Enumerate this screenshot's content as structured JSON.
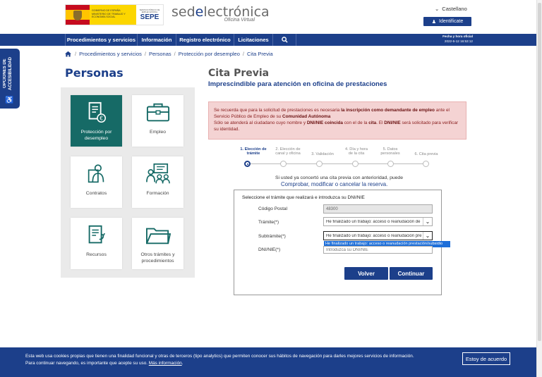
{
  "header": {
    "gov_text": "GOBIERNO DE ESPAÑA  MINISTERIO DE TRABAJO Y ECONOMÍA SOCIAL",
    "gov_right_text": "SERVICIO PÚBLICO DE EMPLEO ESTATAL",
    "sepe": "SEPE",
    "sede_pre": "sed",
    "sede_e": "e",
    "sede_post": "lectrónica",
    "sede_sub": "Oficina Virtual",
    "lang_label": "Castellano",
    "identify_label": "Identifícate"
  },
  "nav": {
    "items": [
      "Procedimientos y servicios",
      "Información",
      "Registro electrónico",
      "Licitaciones"
    ],
    "date_label": "Fecha y hora oficial",
    "date_value": "2022-5-12   16:53:12"
  },
  "breadcrumb": [
    "Procedimientos y servicios",
    "Personas",
    "Protección por desempleo",
    "Cita Previa"
  ],
  "accessibility": {
    "label": "OPCIONES DE ACCESIBILIDAD"
  },
  "left": {
    "title": "Personas",
    "tiles": [
      {
        "label": "Protección por desempleo",
        "icon": "document-euro-icon",
        "active": true
      },
      {
        "label": "Empleo",
        "icon": "briefcase-icon",
        "active": false
      },
      {
        "label": "Contratos",
        "icon": "person-document-icon",
        "active": false
      },
      {
        "label": "Formación",
        "icon": "training-icon",
        "active": false
      },
      {
        "label": "Recursos",
        "icon": "document-arrow-icon",
        "active": false
      },
      {
        "label": "Otros trámites y procedimientos",
        "icon": "folder-icon",
        "active": false
      }
    ]
  },
  "main": {
    "title": "Cita Previa",
    "subtitle": "Imprescindible para atención en oficina de prestaciones",
    "alert": {
      "p1a": "Se recuerda que para la solicitud de prestaciones es necesaria ",
      "p1b": "la inscripción como demandante de empleo",
      "p1c": " ante el Servicio Público de Empleo de su ",
      "p1d": "Comunidad Autónoma",
      "p2a": "Sólo se atenderá al ciudadano cuyo nombre y ",
      "p2b": "DNI/NIE coincida",
      "p2c": " con el de la ",
      "p2d": "cita",
      "p2e": ". El ",
      "p2f": "DNI/NIE",
      "p2g": " será solicitado para verificar su identidad."
    },
    "steps": [
      {
        "l1": "1. Elección de",
        "l2": "trámite",
        "current": true
      },
      {
        "l1": "2. Elección de",
        "l2": "canal y oficina",
        "current": false
      },
      {
        "l1": "3. Validación",
        "l2": "",
        "current": false
      },
      {
        "l1": "4. Día y hora",
        "l2": "de la cita",
        "current": false
      },
      {
        "l1": "5. Datos",
        "l2": "personales",
        "current": false
      },
      {
        "l1": "6. Cita previa",
        "l2": "",
        "current": false
      }
    ],
    "previous_text": "Si usted ya concertó una cita previa con anterioridad, puede",
    "previous_link": "Comprobar, modificar o cancelar la reserva.",
    "form": {
      "heading": "Seleccione el trámite que realizará e introduzca su DNI/NIE",
      "cp_label": "Código Postal",
      "cp_value": "48300",
      "tramite_label": "Trámite(*)",
      "tramite_value": "He finalizado un trabajo: acceso o reanudación de",
      "subtramite_label": "Subtrámite(*)",
      "subtramite_value": "He finalizado un trabajo: acceso o reanudación pre",
      "dropdown_option": "He finalizado un trabajo: acceso o reanudación prestación/subsidio",
      "dni_label": "DNI/NIE(*)",
      "dni_placeholder": "Introduzca su DNI/NIE",
      "back_label": "Volver",
      "continue_label": "Continuar"
    }
  },
  "cookie": {
    "line1": "Esta web usa cookies propias que tienen una finalidad funcional y otras de terceros (tipo analytics) que permiten conocer sus hábitos de navegación para darles mejores servicios de información.",
    "line2": "Para continuar navegando, es importante que acepte su uso. ",
    "link": "Más información",
    "link_suffix": ".",
    "accept": "Estoy de acuerdo"
  },
  "colors": {
    "brand": "#1c3f8a",
    "active_tile": "#166a66",
    "alert_bg": "#f4d3d3"
  }
}
